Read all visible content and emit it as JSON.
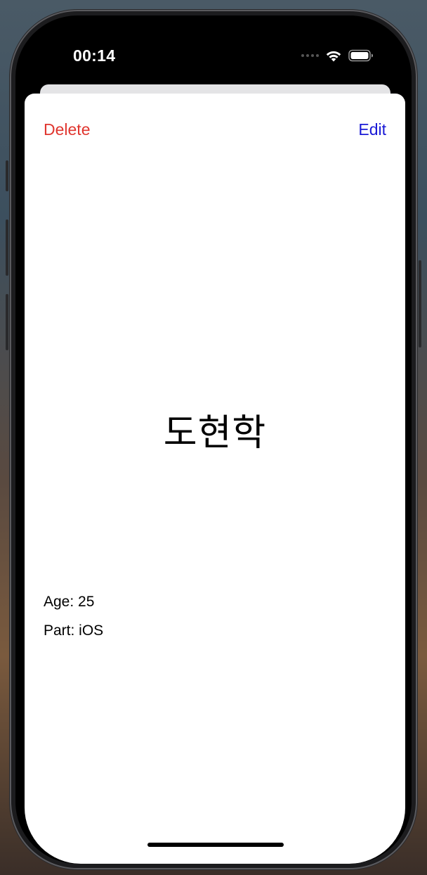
{
  "status_bar": {
    "time": "00:14",
    "wifi_icon": "wifi-icon",
    "battery_icon": "battery-icon"
  },
  "nav": {
    "delete_label": "Delete",
    "edit_label": "Edit"
  },
  "profile": {
    "name": "도현학",
    "age_line": "Age: 25",
    "part_line": "Part: iOS"
  },
  "colors": {
    "delete": "#e0362f",
    "edit": "#1a1ad6",
    "sheet_background": "#ffffff",
    "text": "#000000"
  }
}
